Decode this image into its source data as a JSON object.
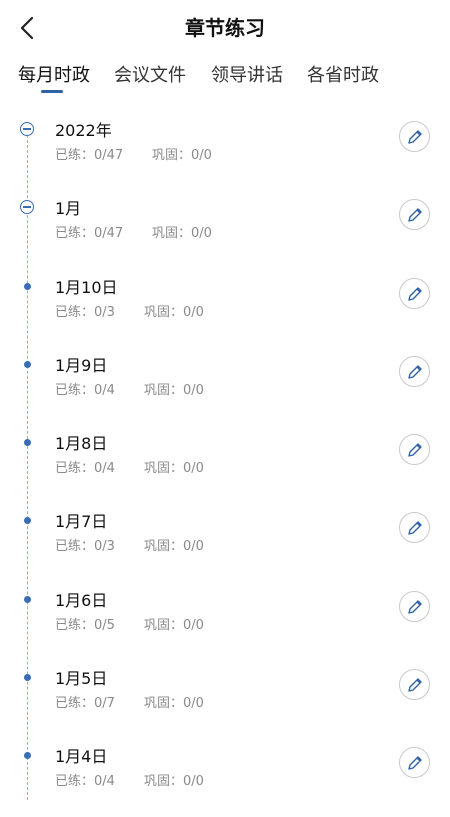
{
  "header": {
    "title": "章节练习",
    "back_icon": "chevron-left-icon"
  },
  "tabs": [
    {
      "label": "每月时政",
      "active": true
    },
    {
      "label": "会议文件",
      "active": false
    },
    {
      "label": "领导讲话",
      "active": false
    },
    {
      "label": "各省时政",
      "active": false
    }
  ],
  "colors": {
    "accent": "#2f62a6",
    "timeline": "#3a6db3",
    "muted_text": "#8a8a8a"
  },
  "items": [
    {
      "title": "2022年",
      "practiced": "已练：0/47",
      "consolidated": "巩固：0/0",
      "node": "collapse"
    },
    {
      "title": "1月",
      "practiced": "已练：0/47",
      "consolidated": "巩固：0/0",
      "node": "collapse"
    },
    {
      "title": "1月10日",
      "practiced": "已练：0/3",
      "consolidated": "巩固：0/0",
      "node": "dot"
    },
    {
      "title": "1月9日",
      "practiced": "已练：0/4",
      "consolidated": "巩固：0/0",
      "node": "dot"
    },
    {
      "title": "1月8日",
      "practiced": "已练：0/4",
      "consolidated": "巩固：0/0",
      "node": "dot"
    },
    {
      "title": "1月7日",
      "practiced": "已练：0/3",
      "consolidated": "巩固：0/0",
      "node": "dot"
    },
    {
      "title": "1月6日",
      "practiced": "已练：0/5",
      "consolidated": "巩固：0/0",
      "node": "dot"
    },
    {
      "title": "1月5日",
      "practiced": "已练：0/7",
      "consolidated": "巩固：0/0",
      "node": "dot"
    },
    {
      "title": "1月4日",
      "practiced": "已练：0/4",
      "consolidated": "巩固：0/0",
      "node": "dot"
    }
  ]
}
